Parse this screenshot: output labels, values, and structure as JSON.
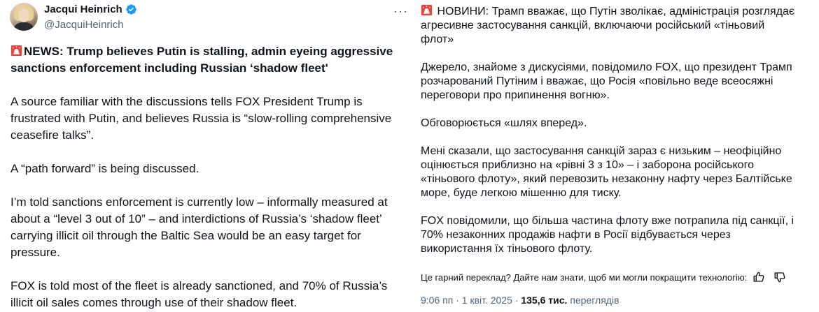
{
  "author": {
    "name": "Jacqui Heinrich",
    "handle": "@JacquiHeinrich",
    "verified_icon": "verified-badge-icon",
    "accent_color": "#1d9bf0"
  },
  "more_button": "···",
  "tweet": {
    "headline": "NEWS: Trump believes Putin is stalling, admin eyeing aggressive sanctions enforcement including Russian ‘shadow fleet'",
    "paragraphs": [
      "A source familiar with the discussions tells FOX President Trump is frustrated with Putin, and believes Russia is “slow-rolling comprehensive ceasefire talks”.",
      "A “path forward” is being discussed.",
      "I’m told sanctions enforcement is currently low – informally measured at about a “level 3 out of 10” – and interdictions of Russia’s ‘shadow fleet’ carrying illicit oil through the Baltic Sea would be an easy target for pressure.",
      "FOX is told most of the fleet is already sanctioned, and 70% of Russia’s illicit oil sales comes through use of their shadow fleet."
    ]
  },
  "translation": {
    "headline_lines": [
      "НОВИНИ: Трамп вважає, що Путін зволікає, адміністрація розглядає",
      "агресивне застосування санкцій, включаючи російський «тіньовий",
      "флот»"
    ],
    "para1_lines": [
      "Джерело, знайоме з дискусіями, повідомило FOX, що президент Трамп",
      "розчарований Путіним і вважає, що Росія «повільно веде всеосяжні",
      "переговори про припинення вогню»."
    ],
    "para2_lines": [
      "Обговорюється «шлях вперед»."
    ],
    "para3_lines": [
      "Мені сказали, що застосування санкцій зараз є низьким – неофіційно",
      "оцінюється приблизно на «рівні 3 з 10» – і заборона російського",
      "«тіньового флоту», який перевозить незаконну нафту через Балтійське",
      "море, буде легкою мішенню для тиску."
    ],
    "para4_lines": [
      "FOX повідомили, що більша частина флоту вже потрапила під санкції, і",
      "70% незаконних продажів нафти в Росії відбувається через",
      "використання їх тіньового флоту."
    ],
    "feedback_text": "Це гарний переклад? Дайте нам знати, щоб ми могли покращити технологію:"
  },
  "meta": {
    "time": "9:06 пп",
    "separator": "·",
    "date": "1 квіт. 2025",
    "views_count": "135,6 тис.",
    "views_label": "переглядів"
  }
}
